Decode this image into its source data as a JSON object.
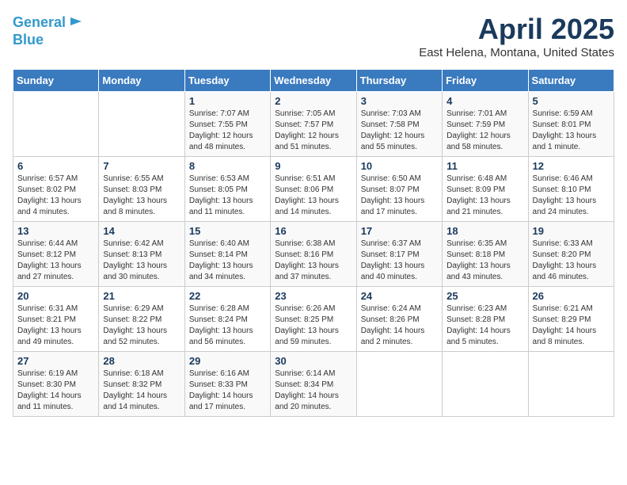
{
  "logo": {
    "line1": "General",
    "line2": "Blue"
  },
  "title": "April 2025",
  "subtitle": "East Helena, Montana, United States",
  "weekdays": [
    "Sunday",
    "Monday",
    "Tuesday",
    "Wednesday",
    "Thursday",
    "Friday",
    "Saturday"
  ],
  "weeks": [
    [
      {
        "day": "",
        "info": ""
      },
      {
        "day": "",
        "info": ""
      },
      {
        "day": "1",
        "info": "Sunrise: 7:07 AM\nSunset: 7:55 PM\nDaylight: 12 hours and 48 minutes."
      },
      {
        "day": "2",
        "info": "Sunrise: 7:05 AM\nSunset: 7:57 PM\nDaylight: 12 hours and 51 minutes."
      },
      {
        "day": "3",
        "info": "Sunrise: 7:03 AM\nSunset: 7:58 PM\nDaylight: 12 hours and 55 minutes."
      },
      {
        "day": "4",
        "info": "Sunrise: 7:01 AM\nSunset: 7:59 PM\nDaylight: 12 hours and 58 minutes."
      },
      {
        "day": "5",
        "info": "Sunrise: 6:59 AM\nSunset: 8:01 PM\nDaylight: 13 hours and 1 minute."
      }
    ],
    [
      {
        "day": "6",
        "info": "Sunrise: 6:57 AM\nSunset: 8:02 PM\nDaylight: 13 hours and 4 minutes."
      },
      {
        "day": "7",
        "info": "Sunrise: 6:55 AM\nSunset: 8:03 PM\nDaylight: 13 hours and 8 minutes."
      },
      {
        "day": "8",
        "info": "Sunrise: 6:53 AM\nSunset: 8:05 PM\nDaylight: 13 hours and 11 minutes."
      },
      {
        "day": "9",
        "info": "Sunrise: 6:51 AM\nSunset: 8:06 PM\nDaylight: 13 hours and 14 minutes."
      },
      {
        "day": "10",
        "info": "Sunrise: 6:50 AM\nSunset: 8:07 PM\nDaylight: 13 hours and 17 minutes."
      },
      {
        "day": "11",
        "info": "Sunrise: 6:48 AM\nSunset: 8:09 PM\nDaylight: 13 hours and 21 minutes."
      },
      {
        "day": "12",
        "info": "Sunrise: 6:46 AM\nSunset: 8:10 PM\nDaylight: 13 hours and 24 minutes."
      }
    ],
    [
      {
        "day": "13",
        "info": "Sunrise: 6:44 AM\nSunset: 8:12 PM\nDaylight: 13 hours and 27 minutes."
      },
      {
        "day": "14",
        "info": "Sunrise: 6:42 AM\nSunset: 8:13 PM\nDaylight: 13 hours and 30 minutes."
      },
      {
        "day": "15",
        "info": "Sunrise: 6:40 AM\nSunset: 8:14 PM\nDaylight: 13 hours and 34 minutes."
      },
      {
        "day": "16",
        "info": "Sunrise: 6:38 AM\nSunset: 8:16 PM\nDaylight: 13 hours and 37 minutes."
      },
      {
        "day": "17",
        "info": "Sunrise: 6:37 AM\nSunset: 8:17 PM\nDaylight: 13 hours and 40 minutes."
      },
      {
        "day": "18",
        "info": "Sunrise: 6:35 AM\nSunset: 8:18 PM\nDaylight: 13 hours and 43 minutes."
      },
      {
        "day": "19",
        "info": "Sunrise: 6:33 AM\nSunset: 8:20 PM\nDaylight: 13 hours and 46 minutes."
      }
    ],
    [
      {
        "day": "20",
        "info": "Sunrise: 6:31 AM\nSunset: 8:21 PM\nDaylight: 13 hours and 49 minutes."
      },
      {
        "day": "21",
        "info": "Sunrise: 6:29 AM\nSunset: 8:22 PM\nDaylight: 13 hours and 52 minutes."
      },
      {
        "day": "22",
        "info": "Sunrise: 6:28 AM\nSunset: 8:24 PM\nDaylight: 13 hours and 56 minutes."
      },
      {
        "day": "23",
        "info": "Sunrise: 6:26 AM\nSunset: 8:25 PM\nDaylight: 13 hours and 59 minutes."
      },
      {
        "day": "24",
        "info": "Sunrise: 6:24 AM\nSunset: 8:26 PM\nDaylight: 14 hours and 2 minutes."
      },
      {
        "day": "25",
        "info": "Sunrise: 6:23 AM\nSunset: 8:28 PM\nDaylight: 14 hours and 5 minutes."
      },
      {
        "day": "26",
        "info": "Sunrise: 6:21 AM\nSunset: 8:29 PM\nDaylight: 14 hours and 8 minutes."
      }
    ],
    [
      {
        "day": "27",
        "info": "Sunrise: 6:19 AM\nSunset: 8:30 PM\nDaylight: 14 hours and 11 minutes."
      },
      {
        "day": "28",
        "info": "Sunrise: 6:18 AM\nSunset: 8:32 PM\nDaylight: 14 hours and 14 minutes."
      },
      {
        "day": "29",
        "info": "Sunrise: 6:16 AM\nSunset: 8:33 PM\nDaylight: 14 hours and 17 minutes."
      },
      {
        "day": "30",
        "info": "Sunrise: 6:14 AM\nSunset: 8:34 PM\nDaylight: 14 hours and 20 minutes."
      },
      {
        "day": "",
        "info": ""
      },
      {
        "day": "",
        "info": ""
      },
      {
        "day": "",
        "info": ""
      }
    ]
  ]
}
